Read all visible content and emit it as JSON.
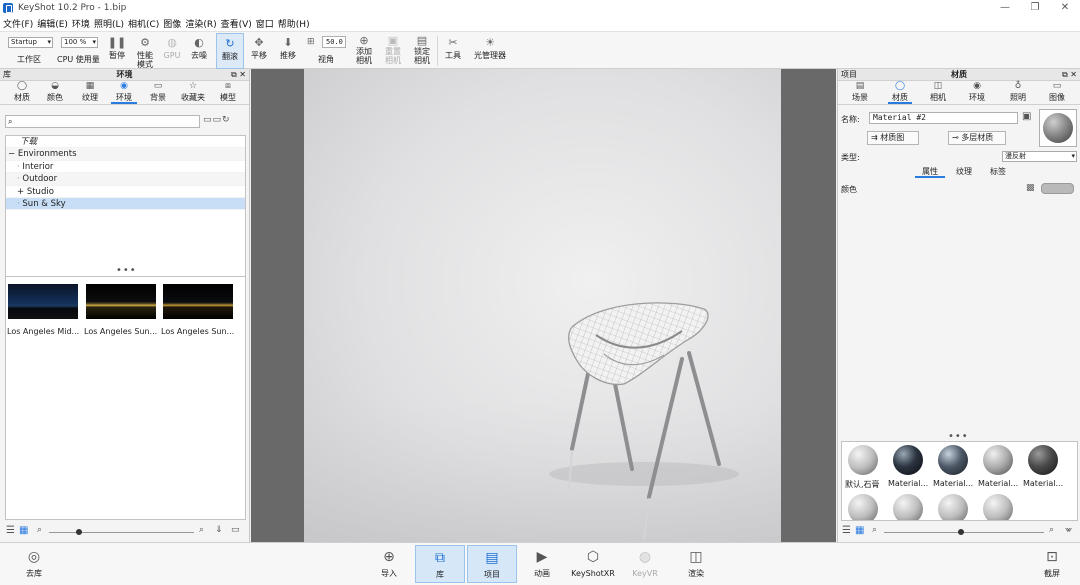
{
  "title": "KeyShot 10.2 Pro  -  1.bip",
  "window_controls": [
    "—",
    "❐",
    "✕"
  ],
  "menu": [
    "文件(F)",
    "编辑(E)",
    "环境",
    "照明(L)",
    "相机(C)",
    "图像",
    "渲染(R)",
    "查看(V)",
    "窗口",
    "帮助(H)"
  ],
  "toolbar": {
    "workspace_value": "Startup",
    "workspace_label": "工作区",
    "zoom_value": "100 %",
    "cpu_label": "CPU  使用量",
    "pause": "暂停",
    "perf_line1": "性能",
    "perf_line2": "模式",
    "gpu": "GPU",
    "denoise": "去噪",
    "tumble": "翻滚",
    "pan": "平移",
    "dolly": "推移",
    "fov_value": "50.0",
    "fov_label": "视角",
    "add_cam_1": "添加",
    "add_cam_2": "相机",
    "reset_cam_1": "重置",
    "reset_cam_2": "相机",
    "lock_cam_1": "锁定",
    "lock_cam_2": "相机",
    "tools": "工具",
    "light_manager": "光管理器"
  },
  "library": {
    "header_left": "库",
    "header_title": "环境",
    "header_ctrls": "⧉ ✕",
    "tabs": [
      "材质",
      "颜色",
      "纹理",
      "环境",
      "背景",
      "收藏夹",
      "模型"
    ],
    "search_icon": "⌕",
    "search_placeholder": "",
    "tree": [
      {
        "label": "下载",
        "indent": 1,
        "italic": true
      },
      {
        "label": "Environments",
        "indent": 0,
        "prefix": "−"
      },
      {
        "label": "Interior",
        "indent": 2,
        "prefix": "·"
      },
      {
        "label": "Outdoor",
        "indent": 2,
        "prefix": "·"
      },
      {
        "label": "Studio",
        "indent": 2,
        "prefix": "+"
      },
      {
        "label": "Sun & Sky",
        "indent": 2,
        "prefix": "·",
        "selected": true
      }
    ],
    "thumbs": [
      "Los Angeles Mid...",
      "Los Angeles Sun...",
      "Los Angeles Sun..."
    ]
  },
  "project": {
    "header_left": "项目",
    "header_title": "材质",
    "header_ctrls": "⧉ ✕",
    "tabs": [
      "场景",
      "材质",
      "相机",
      "环境",
      "照明",
      "图像"
    ],
    "name_label": "名称:",
    "name_value": "Material #2",
    "material_graph": "材质图",
    "multi_material": "多层材质",
    "type_label": "类型:",
    "type_value": "漫反射",
    "sub_tabs": [
      "属性",
      "纹理",
      "标签"
    ],
    "color_label": "颜色",
    "materials": [
      "默认,石膏",
      "Material...",
      "Material...",
      "Material...",
      "Material..."
    ]
  },
  "bottom": {
    "library_btn": "去库",
    "import": "导入",
    "library": "库",
    "project": "项目",
    "animation": "动画",
    "keyshotxr": "KeyShotXR",
    "keyvr": "KeyVR",
    "render": "渲染",
    "screenshot": "截屏"
  }
}
